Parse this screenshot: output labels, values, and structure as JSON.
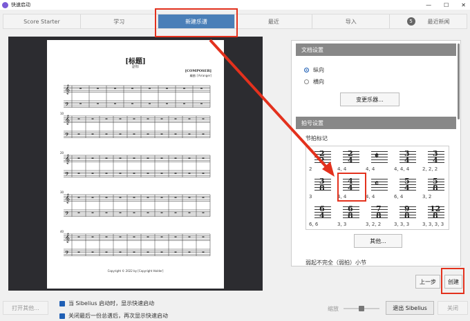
{
  "window": {
    "title": "快速启动",
    "controls": [
      "—",
      "☐",
      "✕"
    ]
  },
  "tabs": [
    {
      "label": "Score Starter",
      "active": false
    },
    {
      "label": "学习",
      "active": false
    },
    {
      "label": "新建乐谱",
      "active": true
    },
    {
      "label": "最近",
      "active": false
    },
    {
      "label": "导入",
      "active": false
    },
    {
      "label": "最近新闻",
      "active": false,
      "badge": "5"
    }
  ],
  "score": {
    "title": "[标题]",
    "subtitle": "副标",
    "composer": "[COMPOSER]",
    "arranger": "编曲: [Arranger]",
    "copyright": "Copyright © 2022 by [Copyright Holder]",
    "measure_numbers": [
      "10",
      "20",
      "30",
      "40"
    ]
  },
  "doc_settings": {
    "header": "文档设置",
    "orientation_portrait": "纵向",
    "orientation_landscape": "横向",
    "change_instruments": "变更乐器..."
  },
  "time_sig": {
    "header": "拍号设置",
    "label": "节拍标记",
    "items": [
      {
        "top": "2",
        "bottom": "2",
        "beam": "2"
      },
      {
        "top": "2",
        "bottom": "4",
        "beam": "4, 4"
      },
      {
        "symbol": "𝄵",
        "beam": "4, 4"
      },
      {
        "top": "3",
        "bottom": "4",
        "beam": "4, 4, 4"
      },
      {
        "top": "3",
        "bottom": "4",
        "beam": "2, 2, 2"
      },
      {
        "top": "3",
        "bottom": "8",
        "beam": "3"
      },
      {
        "top": "4",
        "bottom": "4",
        "beam": "4, 4"
      },
      {
        "symbol": "𝄴",
        "beam": "4, 4"
      },
      {
        "top": "5",
        "bottom": "4",
        "beam": "6, 4"
      },
      {
        "top": "5",
        "bottom": "8",
        "beam": "3, 2"
      },
      {
        "top": "6",
        "bottom": "4",
        "beam": "6, 6"
      },
      {
        "top": "6",
        "bottom": "8",
        "beam": "3, 3"
      },
      {
        "top": "7",
        "bottom": "8",
        "beam": "3, 2, 2"
      },
      {
        "top": "9",
        "bottom": "8",
        "beam": "3, 3, 3"
      },
      {
        "top": "12",
        "bottom": "8",
        "beam": "3, 3, 3, 3"
      }
    ],
    "other_button": "其他...",
    "pickup": "弱起不完全（弱拍）小节"
  },
  "buttons": {
    "back": "上一步",
    "create": "创建",
    "open_other": "打开其他...",
    "exit": "退出 Sibelius",
    "close": "关闭"
  },
  "options": {
    "show_on_start": "当 Sibelius 启动时，显示快速启动",
    "show_after_close": "关闭最后一份总谱后，再次显示快速启动"
  },
  "zoom_label": "缩放",
  "colors": {
    "accent": "#4a7fb8",
    "annotation": "#e3311d"
  }
}
